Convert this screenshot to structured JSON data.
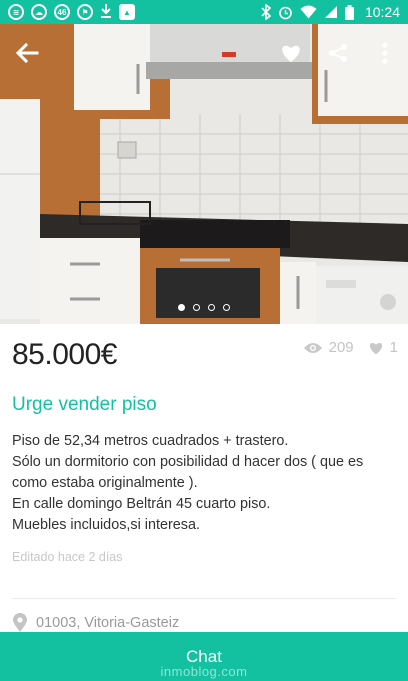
{
  "status_bar": {
    "time": "10:24",
    "left_icons": [
      "spotify-icon",
      "cloud-icon",
      "notification-46-icon",
      "flag-icon",
      "download-icon",
      "image-icon"
    ],
    "notification_badge": "46",
    "right_icons": [
      "bluetooth-icon",
      "alarm-icon",
      "wifi-icon",
      "signal-icon",
      "battery-icon"
    ],
    "background_color": "#13c1a1"
  },
  "gallery": {
    "image_count": 4,
    "active_index": 0
  },
  "listing": {
    "price": "85.000€",
    "views": "209",
    "favorites": "1",
    "title": "Urge vender piso",
    "description_lines": [
      "Piso de 52,34 metros cuadrados + trastero.",
      "Sólo un dormitorio con posibilidad d hacer dos ( que es como estaba originalmente ).",
      "En calle domingo Beltrán 45 cuarto piso.",
      "Muebles incluidos,si interesa."
    ],
    "edited": "Editado hace 2 días",
    "location": "01003, Vitoria-Gasteiz"
  },
  "actions": {
    "chat_label": "Chat"
  },
  "watermark": "inmoblog.com",
  "colors": {
    "accent": "#13c1a1",
    "price_text": "#222222",
    "muted": "#c4c4c4"
  }
}
